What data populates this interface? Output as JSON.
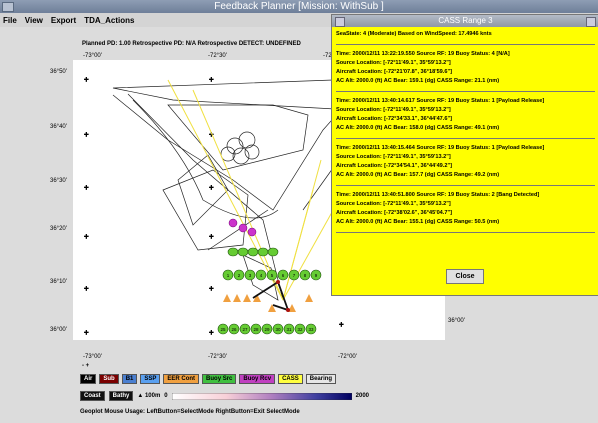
{
  "window": {
    "title": "Feedback Planner [Mission: WithSub ]"
  },
  "menu": [
    "File",
    "View",
    "Export",
    "TDA_Actions"
  ],
  "info_line": "Planned PD: 1.00   Retrospective PD: N/A   Retrospective DETECT: UNDEFINED",
  "map": {
    "lon_labels_top": [
      "-73°00'",
      "-72°30'",
      "-72"
    ],
    "lon_labels_bottom": [
      "-73°00'",
      "-72°30'",
      "-72°00'"
    ],
    "lat_labels": [
      "36°50'",
      "36°40'",
      "36°30'",
      "36°20'",
      "36°10'",
      "36°00'"
    ],
    "right_lat_label": "36°00'",
    "buoy_row1": [
      "1",
      "2",
      "3",
      "4",
      "5",
      "6",
      "7",
      "8",
      "9",
      "10",
      "11",
      "12"
    ],
    "buoy_row2": [
      "13",
      "14",
      "15",
      "16",
      "17",
      "18",
      "19",
      "20",
      "21",
      "22",
      "23",
      "24"
    ],
    "buoy_row3": [
      "25",
      "26",
      "27",
      "28",
      "29",
      "30",
      "31",
      "32",
      "33",
      "34",
      "35",
      "36"
    ]
  },
  "zoom_symbols": "- +",
  "legend1": [
    {
      "label": "Air",
      "bg": "#000000",
      "fg": "#ffffff"
    },
    {
      "label": "Sub",
      "bg": "#7a0000",
      "fg": "#ffffff"
    },
    {
      "label": "B1",
      "bg": "#4a7fd0",
      "fg": "#000000"
    },
    {
      "label": "SSP",
      "bg": "#5aa0f0",
      "fg": "#000000"
    },
    {
      "label": "EER Cont",
      "bg": "#f0a040",
      "fg": "#000000"
    },
    {
      "label": "Buoy Src",
      "bg": "#40c040",
      "fg": "#000000"
    },
    {
      "label": "Buoy Rcv",
      "bg": "#c040c0",
      "fg": "#000000"
    },
    {
      "label": "CASS",
      "bg": "#ffff40",
      "fg": "#000000"
    },
    {
      "label": "Bearing",
      "bg": "#e6e6e6",
      "fg": "#000000"
    }
  ],
  "legend2": {
    "coast": "Coast",
    "bathy": "Bathy",
    "scale_text": "▲ 100m",
    "zero": "0",
    "max": "2000"
  },
  "status_text": "Geoplot Mouse Usage: LeftButton=SelectMode  RightButton=Exit SelectMode",
  "panel": {
    "title": "CASS Range 3",
    "sea_state": "SeaState: 4 (Moderate)   Based on WindSpeed: 17.4946 knts",
    "records": [
      {
        "time": "Time:  2000/12/11 13:22:19.550  Source RF: 19  Buoy Status: 4  [N/A]",
        "src": "Source Location:  [-72°11'49.1\", 35°59'13.2\"]",
        "ac": "Aircraft Location:  [-72°21'07.8\", 36°18'59.6\"]",
        "alt": "AC Alt:  2000.0 (ft)   AC Bear:  159.1 (dg)  CASS Range:  21.1 (nm)"
      },
      {
        "time": "Time:  2000/12/11 13:40:14.617  Source RF: 19  Buoy Status: 1  [Payload Release]",
        "src": "Source Location:  [-72°11'49.1\", 35°59'13.2\"]",
        "ac": "Aircraft Location:  [-72°34'33.1\", 36°44'47.6\"]",
        "alt": "AC Alt:  2000.0 (ft)   AC Bear:  158.0 (dg)  CASS Range:  49.1 (nm)"
      },
      {
        "time": "Time:  2000/12/11 13:40:15.464  Source RF: 19  Buoy Status: 1  [Payload Release]",
        "src": "Source Location:  [-72°11'49.1\", 35°59'13.2\"]",
        "ac": "Aircraft Location:  [-72°34'54.1\", 36°44'49.2\"]",
        "alt": "AC Alt:  2000.0 (ft)   AC Bear:  157.7 (dg)  CASS Range:  49.2 (nm)"
      },
      {
        "time": "Time:  2000/12/11 13:40:51.800  Source RF: 19  Buoy Status: 2  [Bang Detected]",
        "src": "Source Location:  [-72°11'49.1\", 35°59'13.2\"]",
        "ac": "Aircraft Location:  [-72°38'02.6\", 36°45'04.7\"]",
        "alt": "AC Alt:  2000.0 (ft)   AC Bear:  155.1 (dg)  CASS Range:  50.5 (nm)"
      }
    ],
    "close_label": "Close"
  }
}
